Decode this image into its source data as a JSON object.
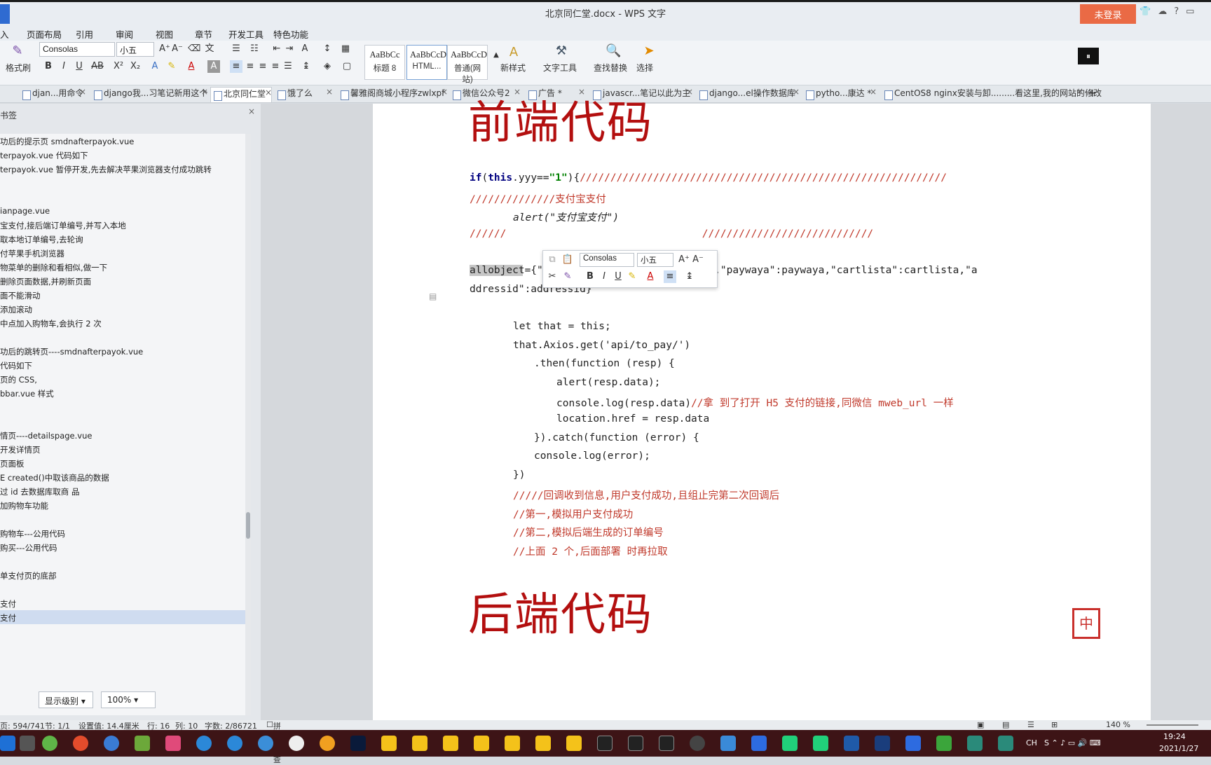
{
  "window": {
    "title": "北京同仁堂.docx - WPS 文字",
    "login": "未登录"
  },
  "menu": [
    "入",
    "页面布局",
    "引用",
    "审阅",
    "视图",
    "章节",
    "开发工具",
    "特色功能"
  ],
  "ribbon": {
    "format_painter": "格式刷",
    "font": "Consolas",
    "size": "小五",
    "styles": [
      {
        "preview": "AaBbCc",
        "label": "标题 8"
      },
      {
        "preview": "AaBbCcD",
        "label": "HTML..."
      },
      {
        "preview": "AaBbCcD",
        "label": "普通(网站)"
      }
    ],
    "new_style": "新样式",
    "text_tools": "文字工具",
    "find_replace": "查找替换",
    "select": "选择"
  },
  "tabs": [
    "djan...用命令",
    "django我...习笔记新用这个",
    "北京同仁堂",
    "饿了么",
    "馨雅阁商城小程序zwlxpf",
    "微信公众号2",
    "广告 *",
    "javascr...笔记以此为主",
    "django...el操作数据库",
    "pytho...康达 *",
    "CentOS8 nginx安装与卸.........看这里,我的网站的修改"
  ],
  "bookmarks": {
    "title": "书签",
    "items": [
      "功后的提示页         smdnafterpayok.vue",
      "terpayok.vue 代码如下",
      "terpayok.vue 暂停开发,先去解决苹果浏览器支付成功跳转",
      "",
      "",
      "ianpage.vue",
      "宝支付,接后端订单编号,并写入本地",
      "取本地订单编号,去轮询",
      "付苹果手机浏览器",
      "物菜单的删除和看相似,做一下",
      "删除页面数据,并刷新页面",
      "面不能滑动",
      "添加滚动",
      "中点加入购物车,会执行 2 次",
      "",
      "功后的跳转页----smdnafterpayok.vue",
      "代码如下",
      "页的 CSS,",
      "bbar.vue 样式",
      "",
      "",
      "情页----detailspage.vue",
      "开发详情页",
      "页面板",
      "E created()中取该商品的数据",
      "过 id 去数据库取商 品",
      "加购物车功能",
      "",
      "购物车---公用代码",
      "购买---公用代码",
      "",
      "单支付页的底部",
      "",
      "支付",
      "支付"
    ],
    "display_level": "显示级别",
    "zoom": "100%"
  },
  "document": {
    "heading_top": "前端代码",
    "heading_bottom": "后端代码",
    "lines": [
      {
        "k": "if",
        "rest": "(this.yyy==\"1\"){",
        "cm": "////////////////////////////////////////////////////////////"
      },
      {
        "cm": "//////////////支付宝支付"
      },
      {
        "text": "alert(\"支付宝支付\")"
      },
      {
        "cm": "//////                                ////////////////////////////"
      },
      {
        "text": "allobject={\"usera\":usera,\"pricea\":pricea,\"paywaya\":paywaya,\"cartlista\":cartlista,\"a"
      },
      {
        "text": "ddressid\":addressid}"
      },
      {
        "text": "let that = this;"
      },
      {
        "text": "that.Axios.get('api/to_pay/')"
      },
      {
        "text": ".then(function (resp) {"
      },
      {
        "text": "alert(resp.data);"
      },
      {
        "text": "console.log(resp.data)",
        "cm": "//拿 到了打开 H5 支付的链接,同微信 mweb_url 一样"
      },
      {
        "text": "location.href = resp.data"
      },
      {
        "text": "}).catch(function (error) {"
      },
      {
        "text": "console.log(error);"
      },
      {
        "text": "})"
      },
      {
        "cm": "/////回调收到信息,用户支付成功,且组止完第二次回调后"
      },
      {
        "cm": "//第一,模拟用户支付成功"
      },
      {
        "cm": "//第二,模拟后端生成的订单编号"
      },
      {
        "cm": "//上面 2 个,后面部署 时再拉取"
      }
    ],
    "minibar": {
      "font": "Consolas",
      "size": "小五"
    }
  },
  "status": {
    "page": "页: 594/741",
    "section": "节: 1/1",
    "setting": "设置值: 14.4厘米",
    "row": "行: 16",
    "col": "列: 10",
    "chars": "字数: 2/86721",
    "spell": "拼写检查",
    "zoom": "140 %"
  },
  "tray": {
    "time": "19:24",
    "date": "2021/1/27",
    "lang": "CH"
  }
}
